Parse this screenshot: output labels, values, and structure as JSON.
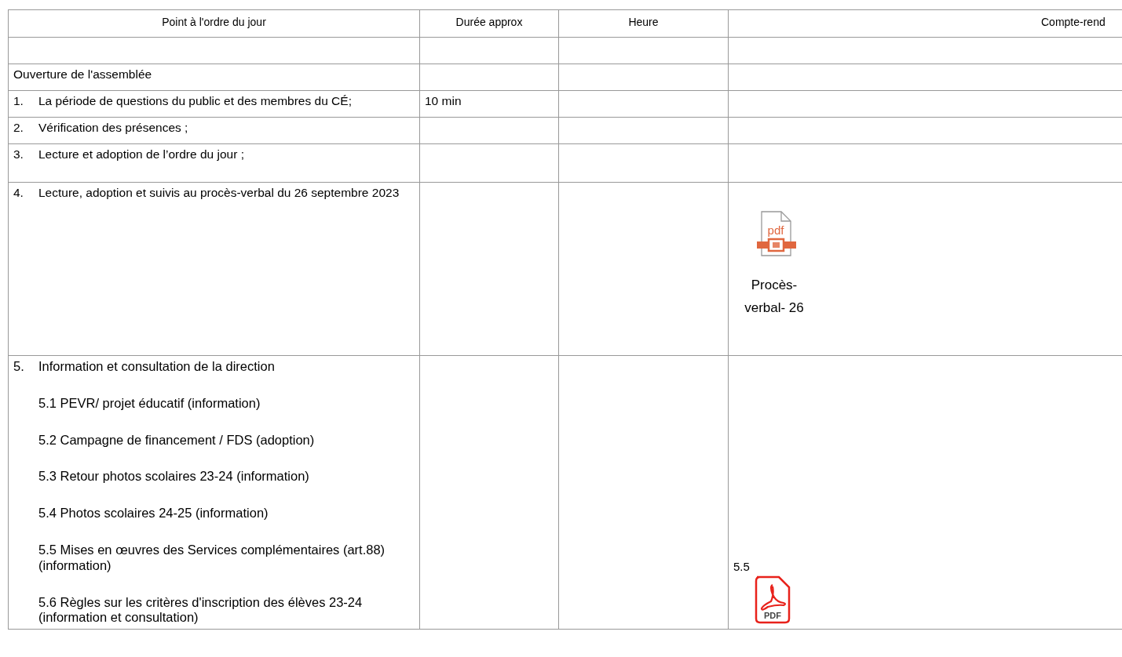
{
  "table": {
    "columns": [
      "Point à l'ordre du jour",
      "Durée approx",
      "Heure",
      "Compte-rend"
    ],
    "rows": [
      {
        "kind": "blank"
      },
      {
        "kind": "plain",
        "item": "Ouverture de l'assemblée"
      },
      {
        "kind": "numbered",
        "number": "1.",
        "item": "La période de questions du public et des membres du CÉ;",
        "duration": "10 min"
      },
      {
        "kind": "numbered",
        "number": "2.",
        "item": "Vérification des présences ;"
      },
      {
        "kind": "numbered",
        "number": "3.",
        "item": "Lecture et adoption de l’ordre du jour ;"
      },
      {
        "kind": "numbered",
        "number": "4.",
        "item": "Lecture, adoption et suivis au procès-verbal du 26 septembre 2023",
        "attachment": {
          "kind": "file",
          "icon_text": "pdf",
          "label": "Procès-verbal- 26"
        }
      },
      {
        "kind": "section",
        "number": "5.",
        "item": "Information et consultation de la direction",
        "subitems": [
          "5.1 PEVR/ projet éducatif  (information)",
          "5.2 Campagne de financement / FDS (adoption)",
          "5.3 Retour photos scolaires 23-24 (information)",
          "5.4 Photos scolaires 24-25 (information)",
          "5.5 Mises en œuvres des Services complémentaires (art.88) (information)",
          "5.6 Règles sur les critères d'inscription des élèves 23-24 (information et consultation)"
        ],
        "attachment": {
          "kind": "acrobat",
          "caption": "5.5",
          "icon_text": "PDF"
        }
      }
    ]
  }
}
